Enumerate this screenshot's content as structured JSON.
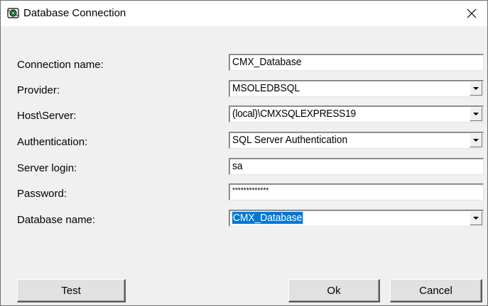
{
  "window": {
    "title": "Database Connection",
    "close_glyph": "✕"
  },
  "form": {
    "connection_name": {
      "label": "Connection name:",
      "value": "CMX_Database"
    },
    "provider": {
      "label": "Provider:",
      "value": "MSOLEDBSQL"
    },
    "host_server": {
      "label": "Host\\Server:",
      "value": "(local)\\CMXSQLEXPRESS19"
    },
    "authentication": {
      "label": "Authentication:",
      "value": "SQL Server Authentication"
    },
    "server_login": {
      "label": "Server login:",
      "value": "sa"
    },
    "password": {
      "label": "Password:",
      "value": "*************"
    },
    "database_name": {
      "label": "Database name:",
      "value": "CMX_Database"
    }
  },
  "buttons": {
    "test": "Test",
    "ok": "Ok",
    "cancel": "Cancel"
  },
  "colors": {
    "selection": "#0078d7",
    "dialog_bg": "#f0f0f0",
    "icon_green": "#1e9e3a"
  },
  "icons": {
    "app": "database-connection-icon",
    "close": "close-icon",
    "dropdown": "chevron-down-icon"
  }
}
